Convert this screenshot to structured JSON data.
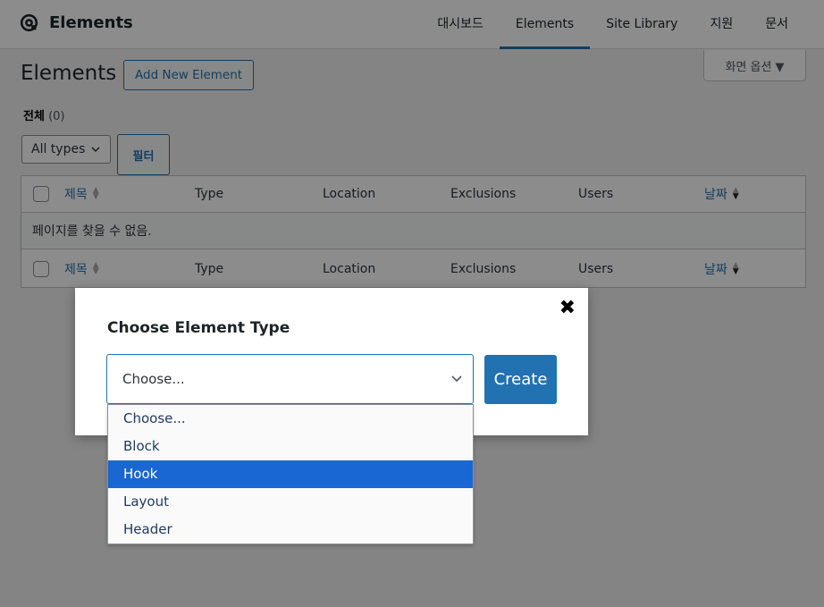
{
  "topbar": {
    "brand": "Elements",
    "nav": [
      {
        "label": "대시보드",
        "active": false
      },
      {
        "label": "Elements",
        "active": true
      },
      {
        "label": "Site Library",
        "active": false
      },
      {
        "label": "지원",
        "active": false
      },
      {
        "label": "문서",
        "active": false
      }
    ]
  },
  "screen_options": "화면 옵션 ▼",
  "page": {
    "title": "Elements",
    "add_new": "Add New Element",
    "subsubsub_all": "전체",
    "subsubsub_count": "(0)",
    "type_filter": "All types",
    "filter_button": "필터"
  },
  "table": {
    "columns": [
      "제목",
      "Type",
      "Location",
      "Exclusions",
      "Users",
      "날짜"
    ],
    "empty_message": "페이지를 찾을 수 없음."
  },
  "modal": {
    "close": "✖",
    "title": "Choose Element Type",
    "select_value": "Choose...",
    "create": "Create",
    "options": [
      "Choose...",
      "Block",
      "Hook",
      "Layout",
      "Header"
    ],
    "highlighted_option": "Hook"
  },
  "colors": {
    "accent": "#2271b1",
    "highlight": "#1967d2"
  }
}
